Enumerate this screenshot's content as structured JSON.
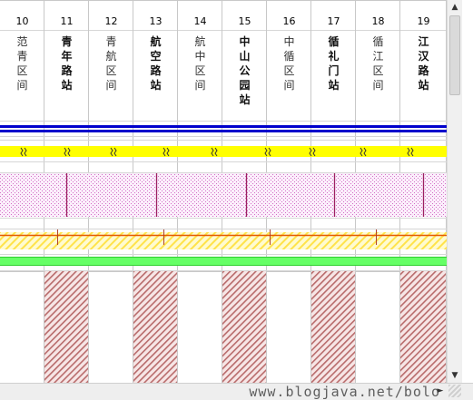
{
  "columns": [
    {
      "num": "10",
      "name": "范青区间",
      "bold": false
    },
    {
      "num": "11",
      "name": "青年路站",
      "bold": true
    },
    {
      "num": "12",
      "name": "青航区间",
      "bold": false
    },
    {
      "num": "13",
      "name": "航空路站",
      "bold": true
    },
    {
      "num": "14",
      "name": "航中区间",
      "bold": false
    },
    {
      "num": "15",
      "name": "中山公园站",
      "bold": true
    },
    {
      "num": "16",
      "name": "中循区间",
      "bold": false
    },
    {
      "num": "17",
      "name": "循礼门站",
      "bold": true
    },
    {
      "num": "18",
      "name": "循江区间",
      "bold": false
    },
    {
      "num": "19",
      "name": "江汉路站",
      "bold": true
    }
  ],
  "scrollbar": {
    "up": "▲",
    "down": "▼",
    "right": "►"
  },
  "status": {
    "watermark": "www.blogjava.net/bolo"
  },
  "colors": {
    "blue": "#0000cc",
    "yellow": "#ffff00",
    "pink_dots": "#e07fd0",
    "magenta_line": "#9c1f60",
    "orange": "#e55a00",
    "green": "#66ff66",
    "hatch": "#b87070"
  }
}
